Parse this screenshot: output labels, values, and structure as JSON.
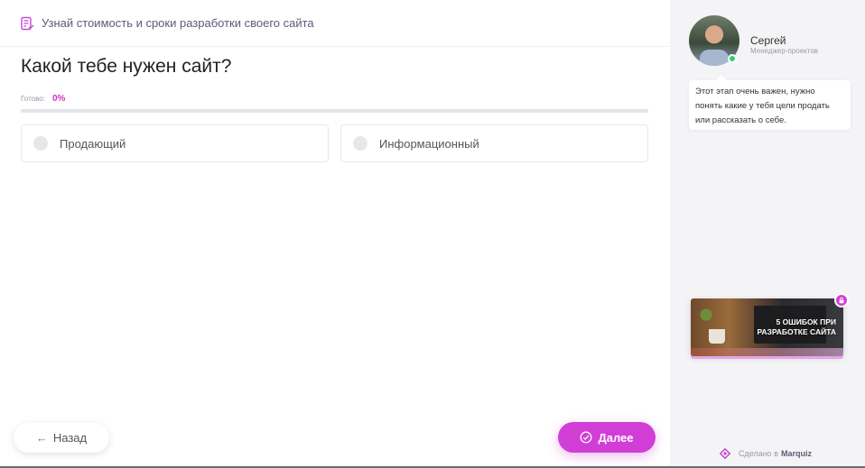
{
  "header": {
    "title": "Узнай стоимость и сроки разработки своего сайта",
    "icon": "form-list-icon"
  },
  "question": {
    "title": "Какой тебе нужен сайт?"
  },
  "progress": {
    "label": "Готово:",
    "percent_text": "0%",
    "value": 0
  },
  "options": [
    {
      "label": "Продающий",
      "selected": false
    },
    {
      "label": "Информационный",
      "selected": false
    }
  ],
  "nav": {
    "back_label": "Назад",
    "next_label": "Далее"
  },
  "manager": {
    "name": "Сергей",
    "role": "Менеджер-проектов",
    "online": true,
    "message": "Этот этап очень важен, нужно понять какие у тебя цели продать или рассказать о себе."
  },
  "promo": {
    "text": "5 ОШИБОК ПРИ РАЗРАБОТКЕ САЙТА"
  },
  "footer": {
    "made_by": "Сделано в",
    "brand": "Marquiz"
  },
  "colors": {
    "accent": "#d13ed6",
    "progress": "#d130cc",
    "online": "#2bd36b"
  }
}
